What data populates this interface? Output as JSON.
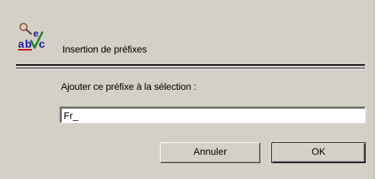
{
  "dialog": {
    "title": "Insertion de préfixes",
    "app_icon": "spellcheck-abc-icon",
    "prompt": "Ajouter ce préfixe à la sélection :",
    "prefix_value": "Fr_",
    "buttons": {
      "cancel_label": "Annuler",
      "ok_label": "OK"
    }
  }
}
